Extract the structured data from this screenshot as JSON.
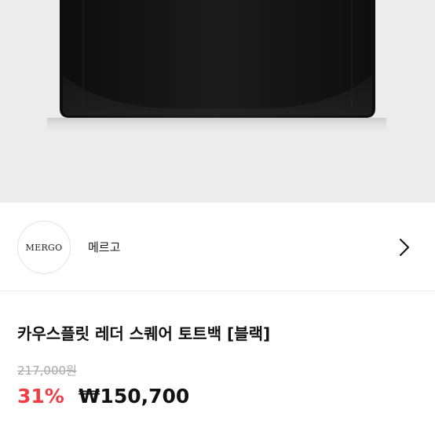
{
  "brand": {
    "logo_text": "MERGO",
    "name": "메르고"
  },
  "product": {
    "title": "카우스플릿 레더 스퀘어 토트백 [블랙]",
    "original_price": "217,000원",
    "discount_rate": "31%",
    "sale_price": "₩150,700"
  },
  "colors": {
    "discount": "#f03c44",
    "image_background": "#ececec",
    "bag": "#141414"
  },
  "icons": {
    "brand_link": "chevron-right-icon"
  }
}
